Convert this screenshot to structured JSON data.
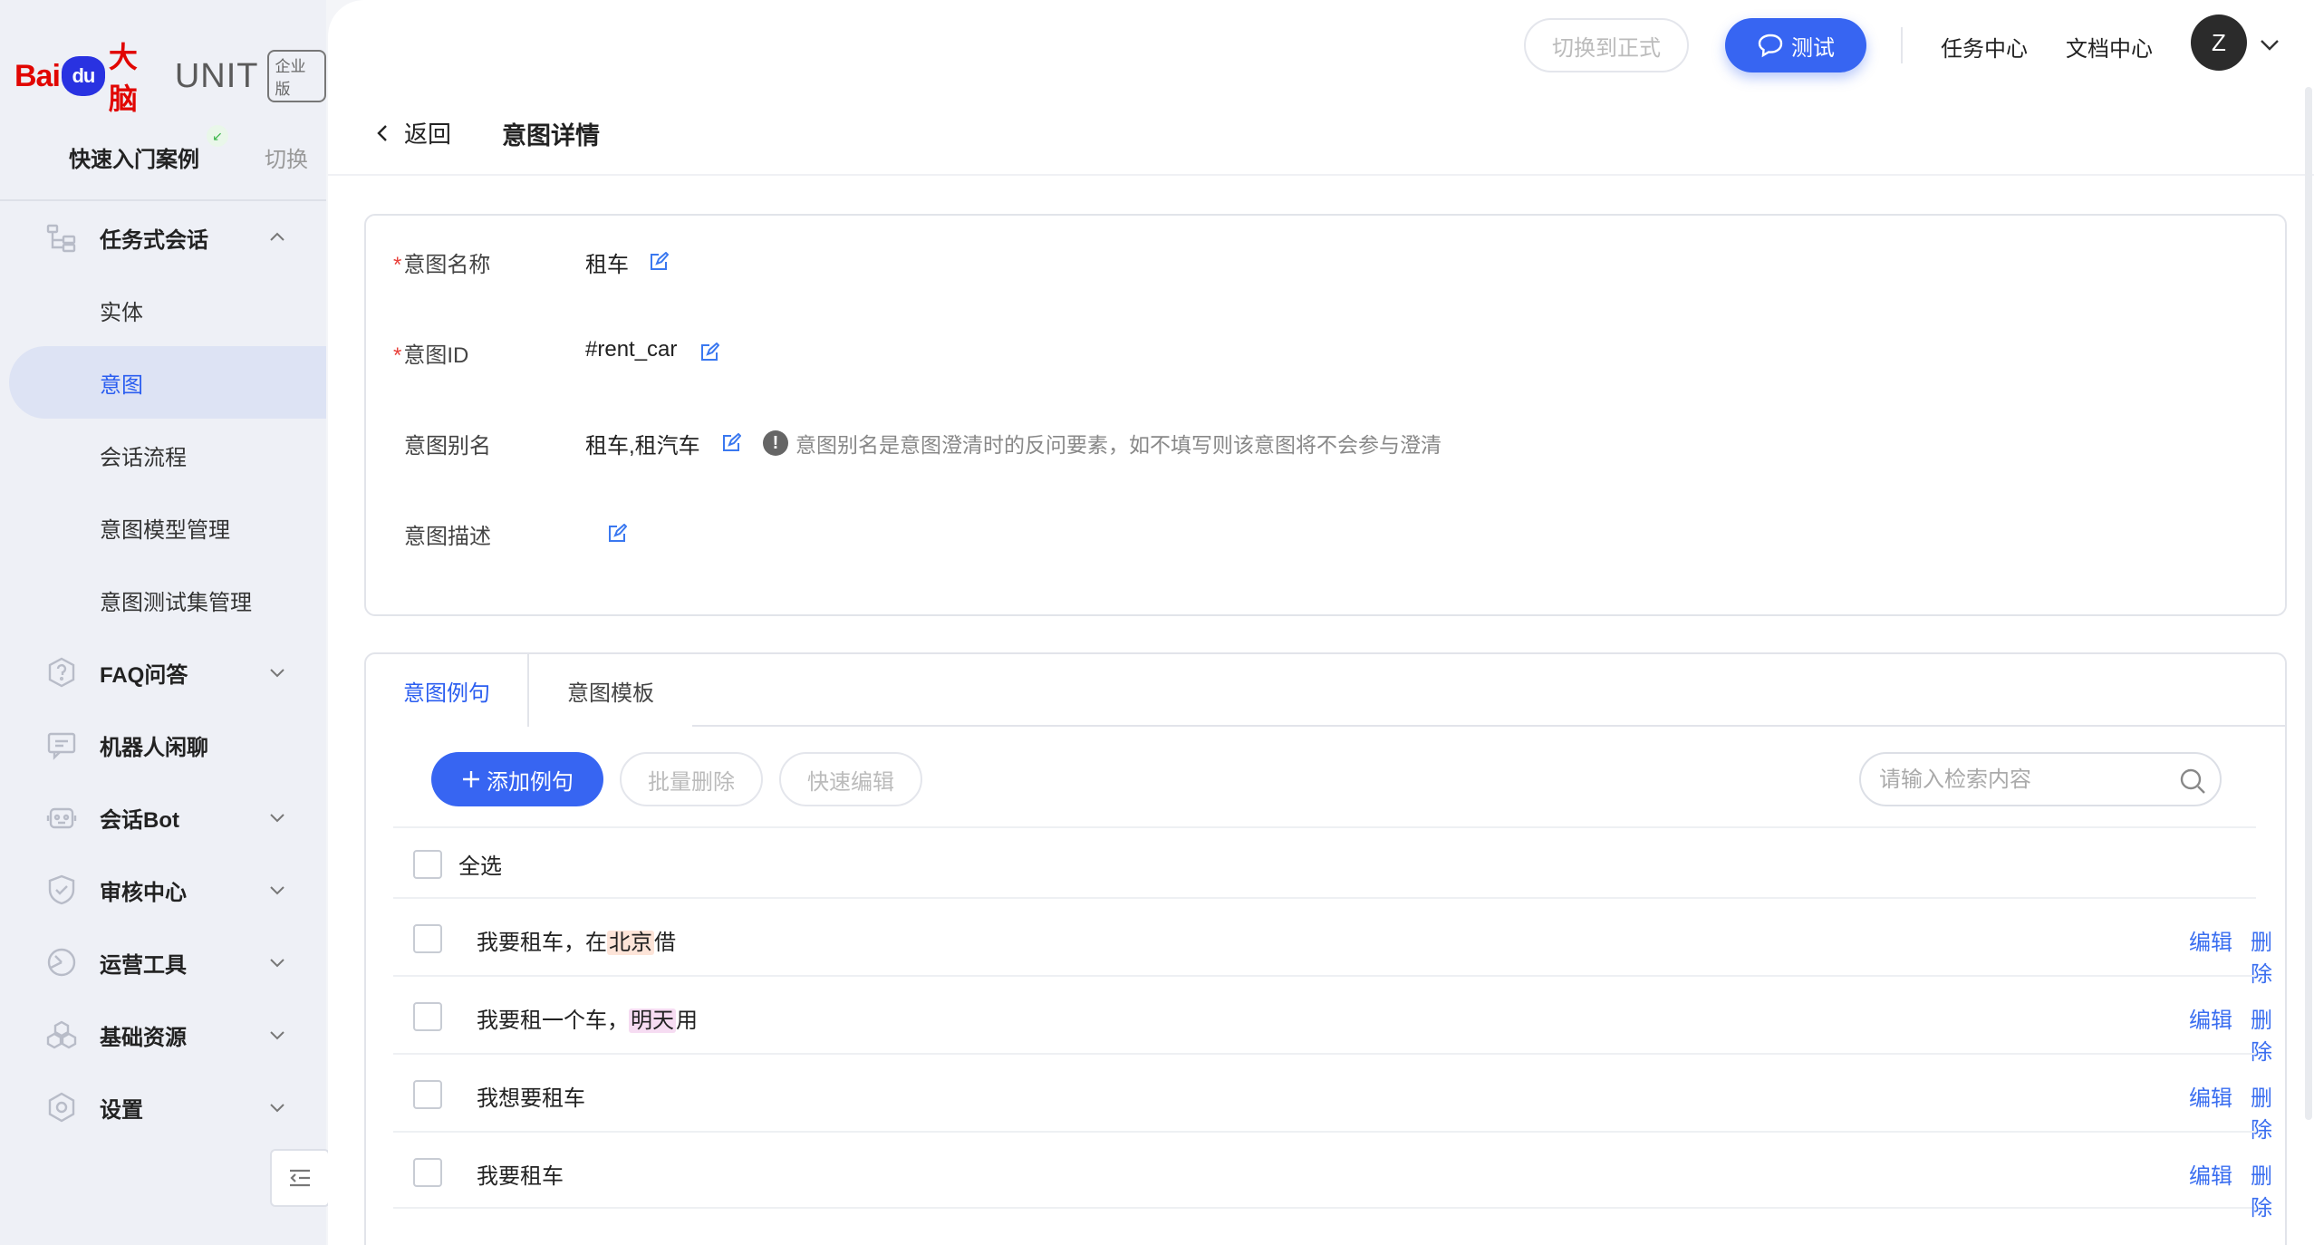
{
  "brand": {
    "baidu": "Bai",
    "paw": "du",
    "danao": "大脑",
    "unit": "UNIT",
    "edition": "企业版"
  },
  "project": {
    "name": "快速入门案例",
    "switch_label": "切换"
  },
  "sidebar": {
    "task_dialog": {
      "label": "任务式会话",
      "items": [
        "实体",
        "意图",
        "会话流程",
        "意图模型管理",
        "意图测试集管理"
      ],
      "active_item": "意图"
    },
    "groups": [
      "FAQ问答",
      "机器人闲聊",
      "会话Bot",
      "审核中心",
      "运营工具",
      "基础资源",
      "设置"
    ]
  },
  "topbar": {
    "switch_formal": "切换到正式",
    "test": "测试",
    "task_center": "任务中心",
    "doc_center": "文档中心",
    "avatar_initial": "Z"
  },
  "page": {
    "back": "返回",
    "title": "意图详情"
  },
  "intent": {
    "name_label": "意图名称",
    "name_value": "租车",
    "id_label": "意图ID",
    "id_value": "#rent_car",
    "alias_label": "意图别名",
    "alias_value": "租车,租汽车",
    "alias_hint": "意图别名是意图澄清时的反问要素，如不填写则该意图将不会参与澄清",
    "desc_label": "意图描述",
    "desc_value": ""
  },
  "tabs": {
    "examples": "意图例句",
    "templates": "意图模板"
  },
  "toolbar": {
    "add": "添加例句",
    "batch_delete": "批量删除",
    "quick_edit": "快速编辑",
    "search_placeholder": "请输入检索内容"
  },
  "list": {
    "select_all": "全选",
    "edit": "编辑",
    "delete": "删除",
    "rows": [
      {
        "pre": "我要租车，在",
        "slot": "北京",
        "post": "借",
        "slot_type": "loc"
      },
      {
        "pre": "我要租一个车，",
        "slot": "明天",
        "post": "用",
        "slot_type": "time"
      },
      {
        "pre": "我想要租车",
        "slot": "",
        "post": "",
        "slot_type": ""
      },
      {
        "pre": "我要租车",
        "slot": "",
        "post": "",
        "slot_type": ""
      }
    ]
  },
  "colors": {
    "accent": "#3765f2",
    "slot_loc": "#fde4d8",
    "slot_time": "#f6dcf2"
  }
}
